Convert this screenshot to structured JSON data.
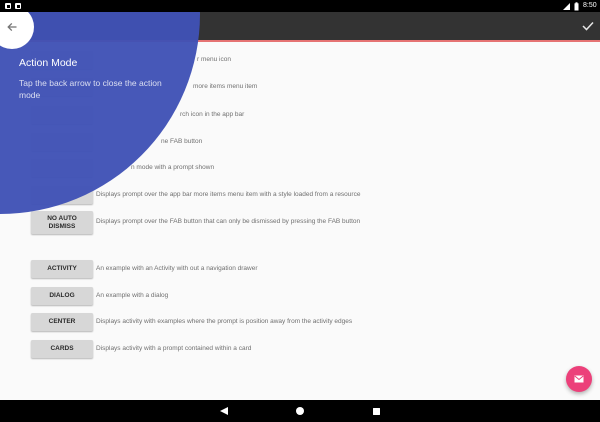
{
  "status_bar": {
    "left_icons": [
      "notification-icon",
      "notification-icon"
    ],
    "signal_icon": "signal-icon",
    "battery_icon": "battery-icon",
    "time": "8:50"
  },
  "action_bar": {
    "background": "#333333",
    "accent_line": "#e57373",
    "close_icon": "back-arrow-icon",
    "done_icon": "check-icon"
  },
  "prompt": {
    "background": "#3f51b5",
    "focal_icon": "back-arrow-icon",
    "title": "Action Mode",
    "text": "Tap the back arrow to close the action mode"
  },
  "examples": {
    "rows": [
      {
        "description": "r menu icon"
      },
      {
        "description": "more items menu item"
      },
      {
        "description": "rch icon in the app bar"
      },
      {
        "description": "ne FAB button"
      },
      {
        "description": "n mode with a prompt shown"
      },
      {
        "description": "Displays prompt over the app bar more items menu item with a style loaded from a resource"
      },
      {
        "button": "NO AUTO DISMISS",
        "description": "Displays prompt over the FAB button that can only be dismissed by pressing the FAB button"
      }
    ]
  },
  "activities": {
    "rows": [
      {
        "button": "ACTIVITY",
        "description": "An example with an Activity with out a navigation drawer"
      },
      {
        "button": "DIALOG",
        "description": "An example with a dialog"
      },
      {
        "button": "CENTER",
        "description": "Displays activity with examples where the prompt is position away from the activity edges"
      },
      {
        "button": "CARDS",
        "description": "Displays activity with a prompt contained within a card"
      }
    ]
  },
  "fab": {
    "icon": "email-icon",
    "color": "#ec407a"
  },
  "nav_bar": {
    "back_icon": "back-icon",
    "home_icon": "home-icon",
    "recents_icon": "recents-icon"
  }
}
